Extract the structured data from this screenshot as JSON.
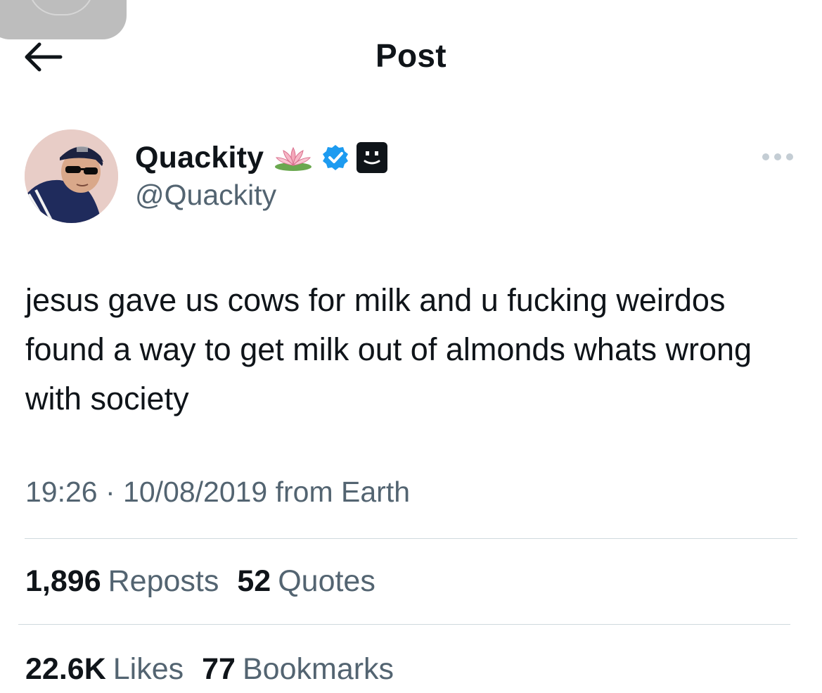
{
  "header": {
    "title": "Post"
  },
  "author": {
    "display_name": "Quackity",
    "handle": "@Quackity",
    "badges": [
      "lotus-icon",
      "verified-badge-icon",
      "automated-bot-icon"
    ]
  },
  "tweet": {
    "text": "jesus gave us cows for milk and u fucking weirdos found a way to get milk out of almonds whats wrong with society",
    "meta": "19:26 · 10/08/2019 from Earth"
  },
  "stats": {
    "reposts": {
      "count": "1,896",
      "label": "Reposts"
    },
    "quotes": {
      "count": "52",
      "label": "Quotes"
    },
    "likes": {
      "count": "22.6K",
      "label": "Likes"
    },
    "bookmarks": {
      "count": "77",
      "label": "Bookmarks"
    }
  },
  "colors": {
    "text_primary": "#0f1419",
    "text_secondary": "#536471",
    "divider": "#cfd9de",
    "verified_blue": "#1d9bf0"
  }
}
